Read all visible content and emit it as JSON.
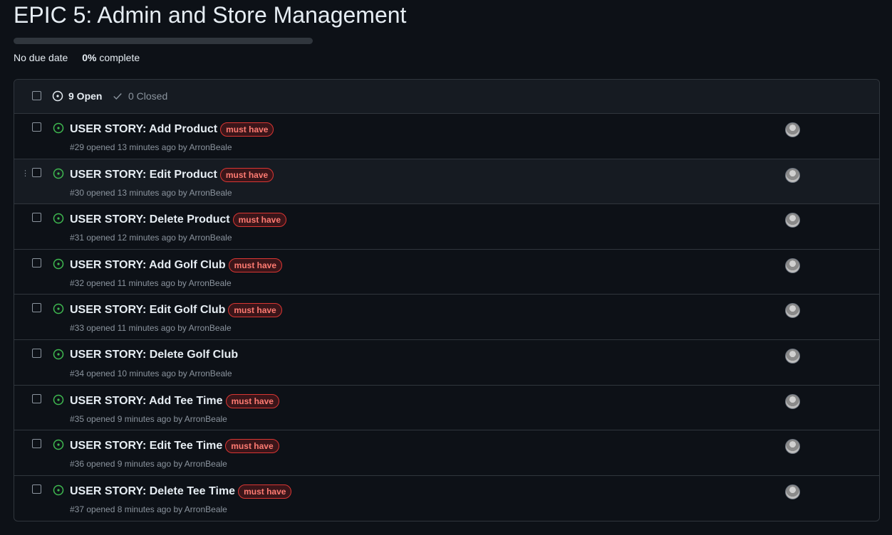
{
  "milestone": {
    "title": "EPIC 5: Admin and Store Management",
    "progress_percent": 0,
    "due_date": "No due date",
    "complete_value": "0%",
    "complete_label": "complete"
  },
  "header": {
    "open_count": "9 Open",
    "closed_count": "0 Closed"
  },
  "issues": [
    {
      "title": "USER STORY: Add Product",
      "label": "must have",
      "meta": "#29 opened 13 minutes ago by ArronBeale"
    },
    {
      "title": "USER STORY: Edit Product",
      "label": "must have",
      "meta": "#30 opened 13 minutes ago by ArronBeale"
    },
    {
      "title": "USER STORY: Delete Product",
      "label": "must have",
      "meta": "#31 opened 12 minutes ago by ArronBeale"
    },
    {
      "title": "USER STORY: Add Golf Club",
      "label": "must have",
      "meta": "#32 opened 11 minutes ago by ArronBeale"
    },
    {
      "title": "USER STORY: Edit Golf Club",
      "label": "must have",
      "meta": "#33 opened 11 minutes ago by ArronBeale"
    },
    {
      "title": "USER STORY: Delete Golf Club",
      "label": "",
      "meta": "#34 opened 10 minutes ago by ArronBeale"
    },
    {
      "title": "USER STORY: Add Tee Time",
      "label": "must have",
      "meta": "#35 opened 9 minutes ago by ArronBeale"
    },
    {
      "title": "USER STORY: Edit Tee Time",
      "label": "must have",
      "meta": "#36 opened 9 minutes ago by ArronBeale"
    },
    {
      "title": "USER STORY: Delete Tee Time",
      "label": "must have",
      "meta": "#37 opened 8 minutes ago by ArronBeale"
    }
  ],
  "colors": {
    "open_icon": "#3fb950",
    "label_text": "#ff7b72",
    "label_border": "#da3633"
  },
  "icons": {
    "open": "issue-opened-icon",
    "closed": "check-icon",
    "drag": "drag-handle-icon"
  }
}
